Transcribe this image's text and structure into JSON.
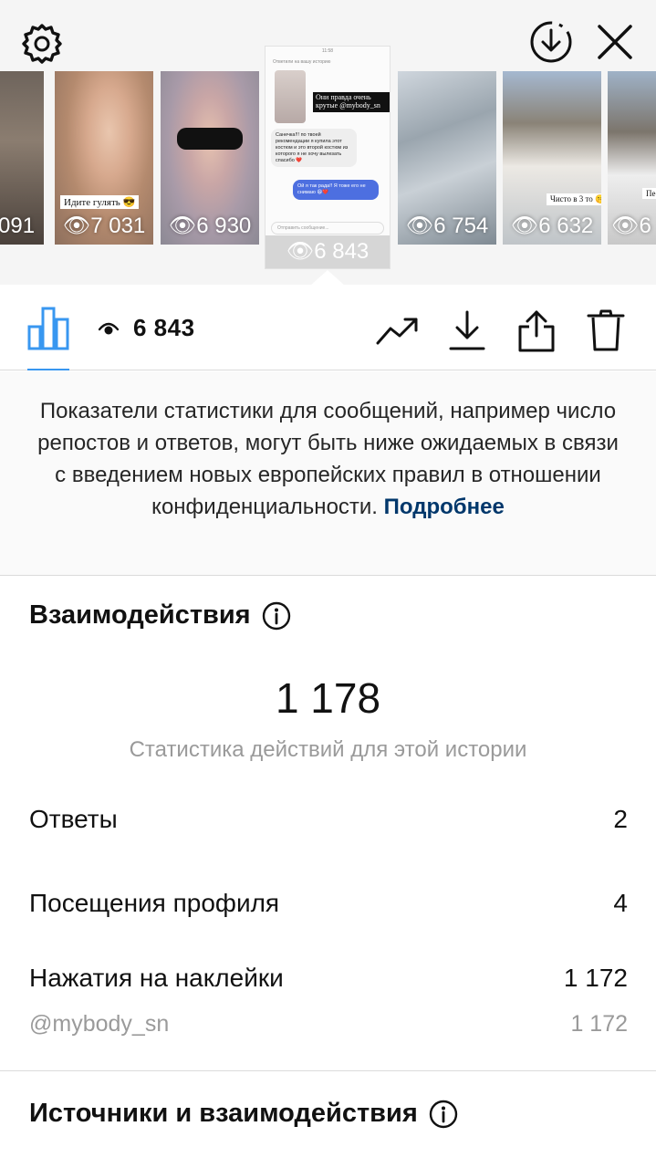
{
  "thumbnails": [
    {
      "count": "091",
      "sticker": ""
    },
    {
      "count": "7 031",
      "sticker": "Идите гулять 😎"
    },
    {
      "count": "6 930",
      "sticker": ""
    },
    {
      "count": "6 843",
      "sticker": "Они правда очень крутые @mybody_sn"
    },
    {
      "count": "6 754",
      "sticker": ""
    },
    {
      "count": "6 632",
      "sticker": "Чисто в 3 то 🤫"
    },
    {
      "count": "6",
      "sticker": "Пе"
    }
  ],
  "selected_story": {
    "time": "11:58",
    "subtitle": "Ответили на вашу историю",
    "sticker": "Они правда очень крутые @mybody_sn",
    "message_in": "Санечка!!! по твоей рекомендации я купила этот костюм и это второй костюм из которого я не хочу вылезать спасибо ❤️",
    "message_out": "Ой я так рада!! Я тоже его не снимаю 😄❤️",
    "input_placeholder": "Отправить сообщение...",
    "count": "6 843"
  },
  "toolbar": {
    "views": "6 843"
  },
  "notice": {
    "text": "Показатели статистики для сообщений, например число репостов и ответов, могут быть ниже ожидаемых в связи с введением новых европейских правил в отношении конфиденциальности. ",
    "link": "Подробнее"
  },
  "interactions": {
    "title": "Взаимодействия",
    "total": "1 178",
    "caption": "Статистика действий для этой истории",
    "rows": [
      {
        "label": "Ответы",
        "value": "2"
      },
      {
        "label": "Посещения профиля",
        "value": "4"
      },
      {
        "label": "Нажатия на наклейки",
        "value": "1 172"
      }
    ],
    "sub_row": {
      "label": "@mybody_sn",
      "value": "1 172"
    }
  },
  "sources": {
    "title": "Источники и взаимодействия"
  },
  "colors": {
    "accent": "#3897f0",
    "link": "#00376b",
    "muted": "#9a9a9a"
  }
}
